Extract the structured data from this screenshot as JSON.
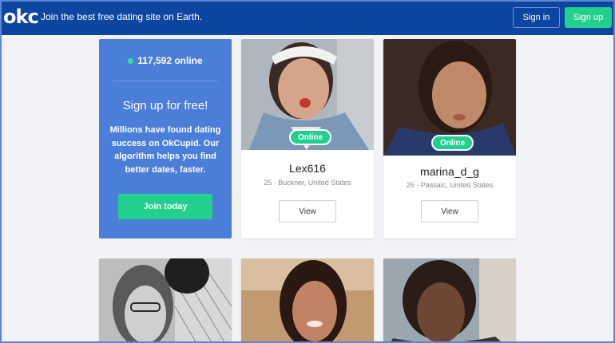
{
  "header": {
    "logo": "okc",
    "tagline": "Join the best free dating site on Earth.",
    "signin_label": "Sign in",
    "signup_label": "Sign up"
  },
  "promo": {
    "online_count": "117,592 online",
    "title": "Sign up for free!",
    "body": "Millions have found dating success on OkCupid. Our algorithm helps you find better dates, faster.",
    "join_label": "Join today"
  },
  "profiles": [
    {
      "username": "Lex616",
      "meta": "25 · Buckner, United States",
      "online_label": "Online",
      "view_label": "View"
    },
    {
      "username": "marina_d_g",
      "meta": "26 · Passaic, United States",
      "online_label": "Online",
      "view_label": "View"
    }
  ],
  "colors": {
    "header_bg": "#0c46a0",
    "accent_green": "#22cf8d",
    "promo_bg": "#4b7ed8"
  }
}
